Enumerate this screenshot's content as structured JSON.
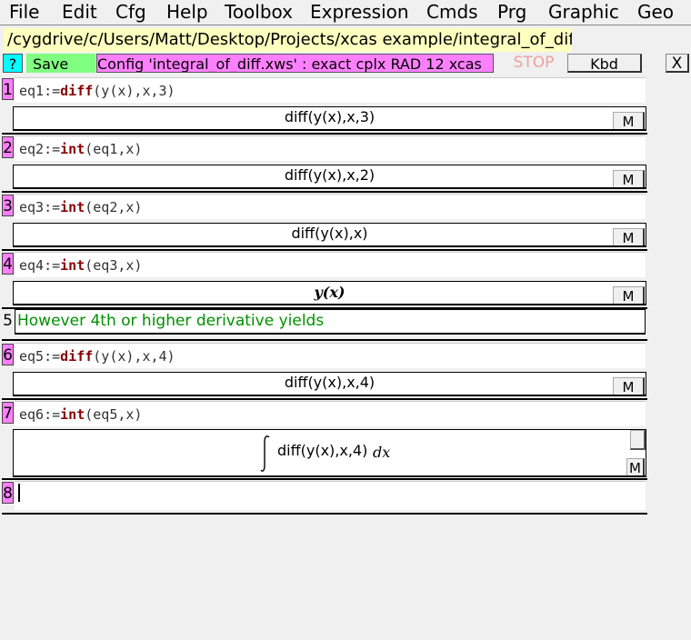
{
  "menu": [
    "File",
    "Edit",
    "Cfg",
    "Help",
    "Toolbox",
    "Expression",
    "Cmds",
    "Prg",
    "Graphic",
    "Geo"
  ],
  "path": "/cygdrive/c/Users/Matt/Desktop/Projects/xcas example/integral_of_diff.xws",
  "toolbar": {
    "help": "?",
    "save": "Save",
    "config": "Config 'integral_of_diff.xws' : exact cplx RAD 12 xcas",
    "stop": "STOP",
    "kbd": "Kbd",
    "close": "X"
  },
  "levels": [
    {
      "num": "1",
      "cmd_name": "eq1:=",
      "cmd_kw": "diff",
      "cmd_args": "(y(x),x,3)",
      "output": "diff(y(x),x,3)",
      "m": "M"
    },
    {
      "num": "2",
      "cmd_name": "eq2:=",
      "cmd_kw": "int",
      "cmd_args": "(eq1,x)",
      "output": "diff(y(x),x,2)",
      "m": "M"
    },
    {
      "num": "3",
      "cmd_name": "eq3:=",
      "cmd_kw": "int",
      "cmd_args": "(eq2,x)",
      "output": "diff(y(x),x)",
      "m": "M"
    },
    {
      "num": "4",
      "cmd_name": "eq4:=",
      "cmd_kw": "int",
      "cmd_args": "(eq3,x)",
      "output": "y(x)",
      "m": "M"
    },
    {
      "num": "5",
      "comment": "However 4th or higher derivative yields"
    },
    {
      "num": "6",
      "cmd_name": "eq5:=",
      "cmd_kw": "diff",
      "cmd_args": "(y(x),x,4)",
      "output": "diff(y(x),x,4)",
      "m": "M"
    },
    {
      "num": "7",
      "cmd_name": "eq6:=",
      "cmd_kw": "int",
      "cmd_args": "(eq5,x)",
      "output": "diff(y(x),x,4)",
      "output_dx": "dx",
      "m": "M"
    },
    {
      "num": "8"
    }
  ]
}
